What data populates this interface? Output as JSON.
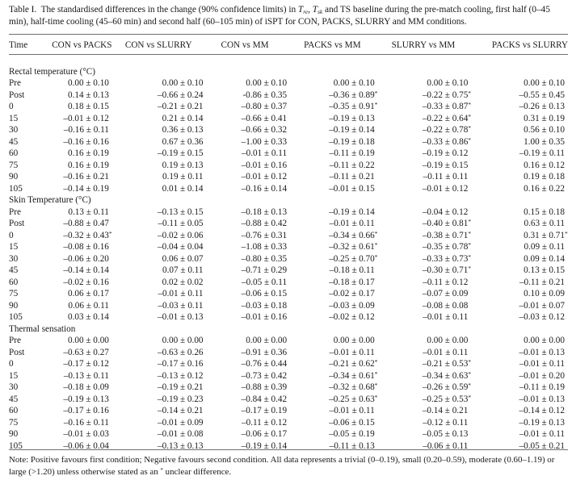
{
  "caption": {
    "label": "Table I.",
    "text_1": "The standardised differences in the change (90% confidence limits) in",
    "var_1": "T",
    "var_1_sub": "re",
    "sep_1": ",",
    "var_2": "T",
    "var_2_sub": "sk",
    "text_2": "and TS baseline during the pre-match cooling, first half (0–45 min), half-time cooling (45–60 min) and second half (60–105 min) of iSPT for CON, PACKS, SLURRY and MM conditions."
  },
  "table": {
    "headers": [
      "Time",
      "CON vs PACKS",
      "CON vs SLURRY",
      "CON vs MM",
      "PACKS vs MM",
      "SLURRY vs MM",
      "PACKS vs SLURRY"
    ],
    "sections": [
      {
        "title": "Rectal temperature (°C)",
        "rows": [
          {
            "time": "Pre",
            "values": [
              "0.00 ± 0.10",
              "0.00 ± 0.10",
              "0.00 ± 0.10",
              "0.00 ± 0.10",
              "0.00 ± 0.10",
              "0.00 ± 0.10"
            ],
            "unclear": [
              false,
              false,
              false,
              false,
              false,
              false
            ]
          },
          {
            "time": "Post",
            "values": [
              "0.14 ± 0.13",
              "–0.66 ± 0.24",
              "-0.86 ± 0.35",
              "–0.36 ± 0.89",
              "–0.22 ± 0.75",
              "–0.55 ± 0.45"
            ],
            "unclear": [
              false,
              false,
              false,
              true,
              true,
              false
            ]
          },
          {
            "time": "0",
            "values": [
              "0.18 ± 0.15",
              "–0.21 ± 0.21",
              "–0.80 ± 0.37",
              "–0.35 ± 0.91",
              "–0.33 ± 0.87",
              "–0.26 ± 0.13"
            ],
            "unclear": [
              false,
              false,
              false,
              true,
              true,
              false
            ]
          },
          {
            "time": "15",
            "values": [
              "–0.01 ± 0.12",
              "0.21 ± 0.14",
              "–0.66 ± 0.41",
              "–0.19 ± 0.13",
              "–0.22 ± 0.64",
              "0.31 ± 0.19"
            ],
            "unclear": [
              false,
              false,
              false,
              false,
              true,
              false
            ]
          },
          {
            "time": "30",
            "values": [
              "–0.16 ± 0.11",
              "0.36 ± 0.13",
              "–0.66 ± 0.32",
              "–0.19 ± 0.14",
              "–0.22 ± 0.78",
              "0.56 ± 0.10"
            ],
            "unclear": [
              false,
              false,
              false,
              false,
              true,
              false
            ]
          },
          {
            "time": "45",
            "values": [
              "–0.16 ± 0.16",
              "0.67 ± 0.36",
              "–1.00 ± 0.33",
              "–0.19 ± 0.18",
              "–0.33 ± 0.86",
              "1.00 ± 0.35"
            ],
            "unclear": [
              false,
              false,
              false,
              false,
              true,
              false
            ]
          },
          {
            "time": "60",
            "values": [
              "0.16 ± 0.19",
              "–0.19 ± 0.15",
              "–0.01 ± 0.11",
              "–0.11 ± 0.19",
              "–0.19 ± 0.12",
              "–0.19 ± 0.11"
            ],
            "unclear": [
              false,
              false,
              false,
              false,
              false,
              false
            ]
          },
          {
            "time": "75",
            "values": [
              "0.16 ± 0.19",
              "0.19 ± 0.13",
              "–0.01 ± 0.16",
              "–0.11 ± 0.22",
              "–0.19 ± 0.15",
              "0.16 ± 0.12"
            ],
            "unclear": [
              false,
              false,
              false,
              false,
              false,
              false
            ]
          },
          {
            "time": "90",
            "values": [
              "–0.16 ± 0.21",
              "0.19 ± 0.11",
              "–0.01 ± 0.12",
              "–0.11 ± 0.21",
              "–0.11 ± 0.11",
              "0.19 ± 0.18"
            ],
            "unclear": [
              false,
              false,
              false,
              false,
              false,
              false
            ]
          },
          {
            "time": "105",
            "values": [
              "–0.14 ± 0.19",
              "0.01 ± 0.14",
              "–0.16 ± 0.14",
              "–0.01 ± 0.15",
              "–0.01 ± 0.12",
              "0.16 ± 0.22"
            ],
            "unclear": [
              false,
              false,
              false,
              false,
              false,
              false
            ]
          }
        ]
      },
      {
        "title": "Skin Temperature (°C)",
        "rows": [
          {
            "time": "Pre",
            "values": [
              "0.13 ± 0.11",
              "–0.13 ± 0.15",
              "–0.18 ± 0.13",
              "–0.19 ± 0.14",
              "–0.04 ± 0.12",
              "0.15 ± 0.18"
            ],
            "unclear": [
              false,
              false,
              false,
              false,
              false,
              false
            ]
          },
          {
            "time": "Post",
            "values": [
              "–0.88 ± 0.47",
              "–0.11 ± 0.05",
              "–0.88 ± 0.42",
              "–0.01 ± 0.11",
              "–0.40 ± 0.81",
              "0.63 ± 0.11"
            ],
            "unclear": [
              false,
              false,
              false,
              false,
              true,
              false
            ]
          },
          {
            "time": "0",
            "values": [
              "–0.32 ± 0.43",
              "–0.02 ± 0.06",
              "–0.76 ± 0.31",
              "–0.34 ± 0.66",
              "–0.38 ± 0.71",
              "0.31 ± 0.71"
            ],
            "unclear": [
              true,
              false,
              false,
              true,
              true,
              true
            ]
          },
          {
            "time": "15",
            "values": [
              "–0.08 ± 0.16",
              "–0.04 ± 0.04",
              "–1.08 ± 0.33",
              "–0.32 ± 0.61",
              "–0.35 ± 0.78",
              "0.09 ± 0.11"
            ],
            "unclear": [
              false,
              false,
              false,
              true,
              true,
              false
            ]
          },
          {
            "time": "30",
            "values": [
              "–0.06 ± 0.20",
              "0.06 ± 0.07",
              "–0.80 ± 0.35",
              "–0.25 ± 0.70",
              "–0.33 ± 0.73",
              "0.09 ± 0.14"
            ],
            "unclear": [
              false,
              false,
              false,
              true,
              true,
              false
            ]
          },
          {
            "time": "45",
            "values": [
              "–0.14 ± 0.14",
              "0.07 ± 0.11",
              "–0.71 ± 0.29",
              "–0.18 ± 0.11",
              "–0.30 ± 0.71",
              "0.13 ± 0.15"
            ],
            "unclear": [
              false,
              false,
              false,
              false,
              true,
              false
            ]
          },
          {
            "time": "60",
            "values": [
              "–0.02 ± 0.16",
              "0.02 ± 0.02",
              "–0.05 ± 0.11",
              "–0.18 ± 0.17",
              "–0.11 ± 0.12",
              "–0.11 ± 0.21"
            ],
            "unclear": [
              false,
              false,
              false,
              false,
              false,
              false
            ]
          },
          {
            "time": "75",
            "values": [
              "0.06 ± 0.17",
              "–0.01 ± 0.11",
              "–0.06 ± 0.15",
              "–0.02 ± 0.17",
              "–0.07 ± 0.09",
              "0.10 ± 0.09"
            ],
            "unclear": [
              false,
              false,
              false,
              false,
              false,
              false
            ]
          },
          {
            "time": "90",
            "values": [
              "0.06 ± 0.11",
              "–0.03 ± 0.11",
              "–0.03 ± 0.18",
              "–0.03 ± 0.09",
              "–0.08 ± 0.08",
              "–0.01 ± 0.07"
            ],
            "unclear": [
              false,
              false,
              false,
              false,
              false,
              false
            ]
          },
          {
            "time": "105",
            "values": [
              "0.03 ± 0.14",
              "–0.01 ± 0.13",
              "–0.01 ± 0.16",
              "–0.02 ± 0.12",
              "–0.01 ± 0.11",
              "–0.03 ± 0.12"
            ],
            "unclear": [
              false,
              false,
              false,
              false,
              false,
              false
            ]
          }
        ]
      },
      {
        "title": "Thermal sensation",
        "rows": [
          {
            "time": "Pre",
            "values": [
              "0.00 ± 0.00",
              "0.00 ± 0.00",
              "0.00 ± 0.00",
              "0.00 ± 0.00",
              "0.00 ± 0.00",
              "0.00 ± 0.00"
            ],
            "unclear": [
              false,
              false,
              false,
              false,
              false,
              false
            ]
          },
          {
            "time": "Post",
            "values": [
              "–0.63 ± 0.27",
              "–0.63 ± 0.26",
              "–0.91 ± 0.36",
              "–0.01 ± 0.11",
              "–0.01 ± 0.11",
              "–0.01 ± 0.13"
            ],
            "unclear": [
              false,
              false,
              false,
              false,
              false,
              false
            ]
          },
          {
            "time": "0",
            "values": [
              "–0.17 ± 0.12",
              "–0.17 ± 0.16",
              "–0.76 ± 0.44",
              "–0.21 ± 0.62",
              "–0.21 ± 0.53",
              "–0.01 ± 0.11"
            ],
            "unclear": [
              false,
              false,
              false,
              true,
              true,
              false
            ]
          },
          {
            "time": "15",
            "values": [
              "–0.13 ± 0.11",
              "–0.13 ± 0.12",
              "–0.73 ± 0.42",
              "–0.34 ± 0.61",
              "–0.34 ± 0.63",
              "–0.01 ± 0.20"
            ],
            "unclear": [
              false,
              false,
              false,
              true,
              true,
              false
            ]
          },
          {
            "time": "30",
            "values": [
              "–0.18 ± 0.09",
              "–0.19 ± 0.21",
              "–0.88 ± 0.39",
              "–0.32 ± 0.68",
              "–0.26 ± 0.59",
              "–0.11 ± 0.19"
            ],
            "unclear": [
              false,
              false,
              false,
              true,
              true,
              false
            ]
          },
          {
            "time": "45",
            "values": [
              "–0.19 ± 0.13",
              "–0.19 ± 0.23",
              "–0.84 ± 0.42",
              "–0.25 ± 0.63",
              "–0.25 ± 0.53",
              "–0.01 ± 0.13"
            ],
            "unclear": [
              false,
              false,
              false,
              true,
              true,
              false
            ]
          },
          {
            "time": "60",
            "values": [
              "–0.17 ± 0.16",
              "–0.14 ± 0.21",
              "–0.17 ± 0.19",
              "–0.01 ± 0.11",
              "–0.14 ± 0.21",
              "–0.14 ± 0.12"
            ],
            "unclear": [
              false,
              false,
              false,
              false,
              false,
              false
            ]
          },
          {
            "time": "75",
            "values": [
              "–0.16 ± 0.11",
              "–0.01 ± 0.09",
              "–0.11 ± 0.12",
              "–0.06 ± 0.15",
              "–0.12 ± 0.11",
              "–0.19 ± 0.13"
            ],
            "unclear": [
              false,
              false,
              false,
              false,
              false,
              false
            ]
          },
          {
            "time": "90",
            "values": [
              "–0.01 ± 0.03",
              "–0.01 ± 0.08",
              "–0.06 ± 0.17",
              "–0.05 ± 0.19",
              "–0.05 ± 0.13",
              "–0.01 ± 0.11"
            ],
            "unclear": [
              false,
              false,
              false,
              false,
              false,
              false
            ]
          },
          {
            "time": "105",
            "values": [
              "–0.06 ± 0.04",
              "–0.13 ± 0.13",
              "–0.19 ± 0.14",
              "–0.11 ± 0.13",
              "–0.06 ± 0.11",
              "–0.05 ± 0.21"
            ],
            "unclear": [
              false,
              false,
              false,
              false,
              false,
              false
            ]
          }
        ]
      }
    ],
    "unclear_marker": "*"
  },
  "note": {
    "text_1": "Note: Positive favours first condition; Negative favours second condition. All data represents a trivial (0–0.19), small (0.20–0.59), moderate (0.60–1.19) or large (>1.20) unless otherwise stated as an",
    "marker": "*",
    "text_2": "unclear difference."
  }
}
